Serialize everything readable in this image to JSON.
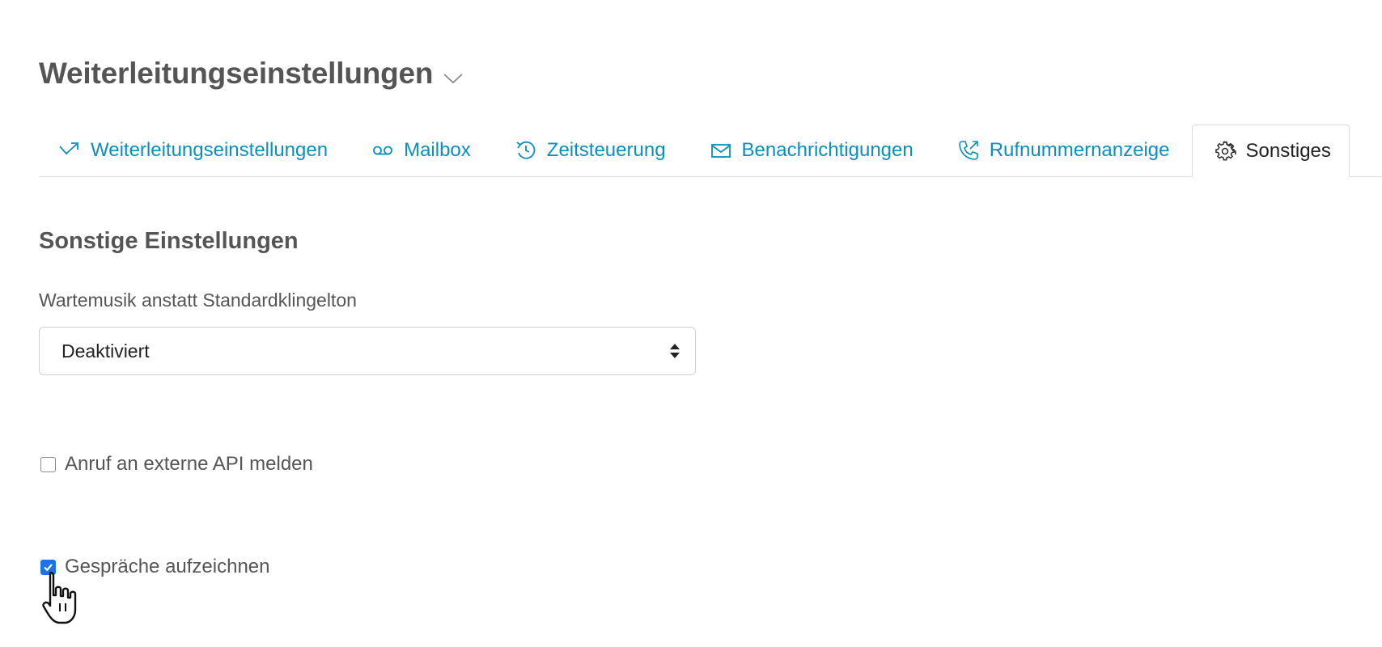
{
  "header": {
    "title": "Weiterleitungseinstellungen"
  },
  "tabs": [
    {
      "label": "Weiterleitungseinstellungen",
      "icon": "forward-arrow-icon",
      "active": false
    },
    {
      "label": "Mailbox",
      "icon": "voicemail-icon",
      "active": false
    },
    {
      "label": "Zeitsteuerung",
      "icon": "clock-history-icon",
      "active": false
    },
    {
      "label": "Benachrichtigungen",
      "icon": "envelope-icon",
      "active": false
    },
    {
      "label": "Rufnummernanzeige",
      "icon": "phone-outgoing-icon",
      "active": false
    },
    {
      "label": "Sonstiges",
      "icon": "gear-icon",
      "active": true
    }
  ],
  "main": {
    "section_title": "Sonstige Einstellungen",
    "music_field": {
      "label": "Wartemusik anstatt Standardklingelton",
      "value": "Deaktiviert"
    },
    "api_checkbox": {
      "label": "Anruf an externe API melden",
      "checked": false
    },
    "record_checkbox": {
      "label": "Gespräche aufzeichnen",
      "checked": true
    }
  },
  "colors": {
    "link": "#0a8fc0",
    "heading": "#555555",
    "active_tab_text": "#222222",
    "checkbox_checked": "#1a73e8"
  }
}
